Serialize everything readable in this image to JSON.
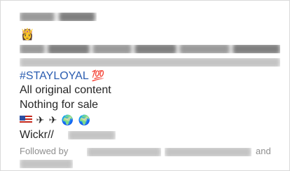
{
  "profile": {
    "crown_emoji": "👸",
    "hashtag": "#STAYLOYAL",
    "hashtag_emoji": "💯",
    "line_original": "All original content",
    "line_sale": "Nothing for sale",
    "emoji_row": "✈ ✈ 🌍 🌍",
    "flag_icon": "us-flag-icon",
    "wickr_label": "Wickr//",
    "followed_by_label": "Followed by",
    "and_label": "and"
  },
  "colors": {
    "hashtag": "#2b5db0",
    "muted_text": "#8e8e8e",
    "body_text": "#262626"
  }
}
